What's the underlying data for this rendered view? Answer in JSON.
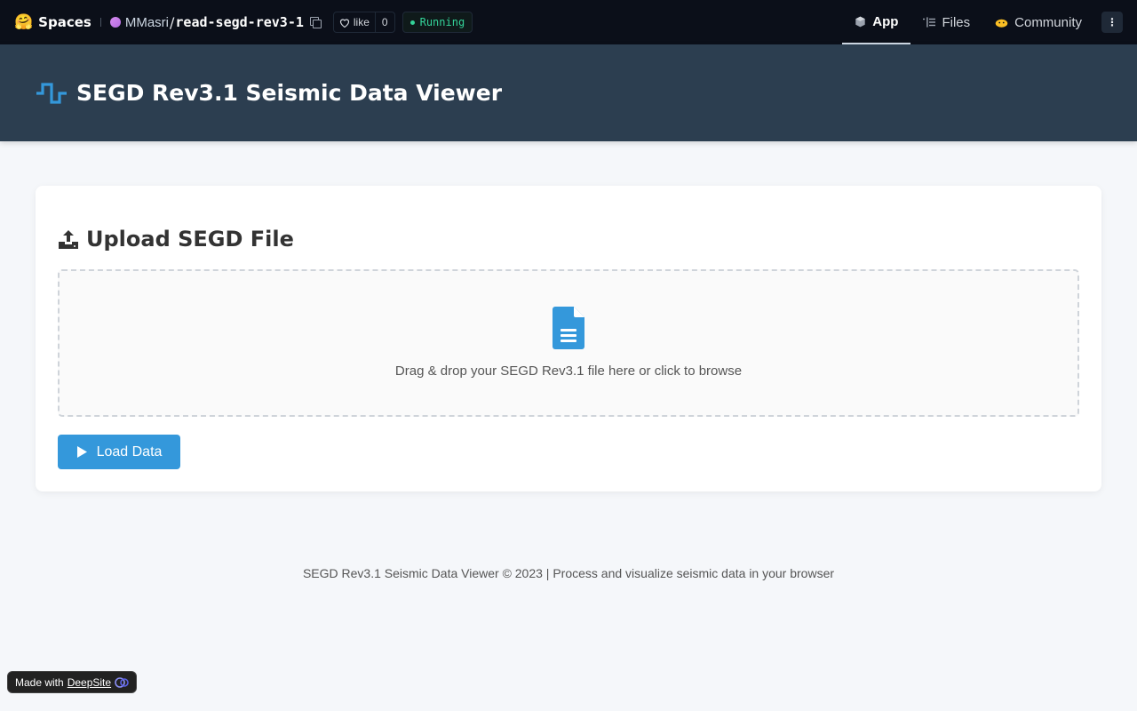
{
  "topbar": {
    "brand_emoji": "🤗",
    "brand_label": "Spaces",
    "owner": "MMasri",
    "slash": "/",
    "repo": "read-segd-rev3-1",
    "like_label": "like",
    "like_count": "0",
    "status": "Running",
    "nav": [
      {
        "label": "App",
        "icon": "cube-icon"
      },
      {
        "label": "Files",
        "icon": "files-icon"
      },
      {
        "label": "Community",
        "icon": "community-icon"
      }
    ],
    "more_label": "⋮"
  },
  "header": {
    "title": "SEGD Rev3.1 Seismic Data Viewer",
    "icon": "waveform-icon",
    "accent_color": "#3498db"
  },
  "upload": {
    "title": "Upload SEGD File",
    "dropzone_text": "Drag & drop your SEGD Rev3.1 file here or click to browse",
    "load_button": "Load Data"
  },
  "footer": {
    "text": "SEGD Rev3.1 Seismic Data Viewer © 2023 | Process and visualize seismic data in your browser"
  },
  "badge": {
    "prefix": "Made with",
    "link": "DeepSite"
  }
}
